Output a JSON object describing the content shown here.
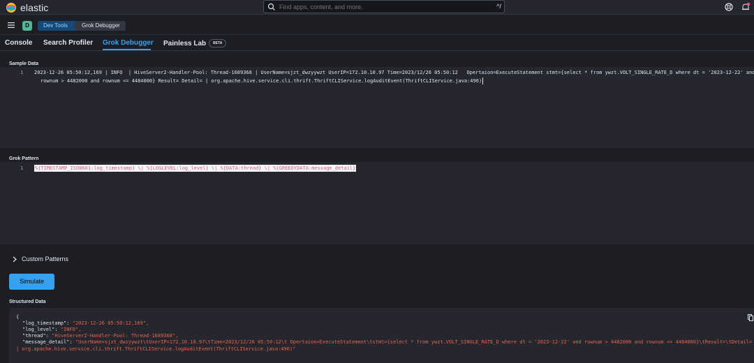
{
  "app": {
    "logo_text": "elastic",
    "search_placeholder": "Find apps, content, and more.",
    "search_shortcut": "^/",
    "space_initial": "D",
    "breadcrumbs": [
      "Dev Tools",
      "Grok Debugger"
    ]
  },
  "tabs": [
    {
      "label": "Console",
      "active": false
    },
    {
      "label": "Search Profiler",
      "active": false
    },
    {
      "label": "Grok Debugger",
      "active": true
    },
    {
      "label": "Painless Lab",
      "active": false,
      "badge": "BETA"
    }
  ],
  "sample_data": {
    "label": "Sample Data",
    "line_number": "1",
    "line1": "2023-12-26 05:50:12,169 | INFO  | HiveServer2-Handler-Pool: Thread-1689368 | UserName=sjzt_dwzyywzt UserIP=172.10.10.97 Time=2023/12/26 05:50:12   Opertaion=ExecuteStatement stmt={select * from ywzt.VOLT_SINGLE_RATE_D where dt = '2023-12-22' and",
    "line2": "rownum > 4482000 and rownum <= 4484000} Result= Detail= | org.apache.hive.service.cli.thrift.ThriftCLIService.logAuditEvent(ThriftCLIService.java:496)"
  },
  "grok_pattern": {
    "label": "Grok Pattern",
    "line_number": "1",
    "value": "%{TIMESTAMP_ISO8601:log_timestamp} \\| %{LOGLEVEL:log_level} \\| %{DATA:thread} \\| %{GREEDYDATA:message_detail}"
  },
  "custom_patterns": {
    "label": "Custom Patterns"
  },
  "simulate": {
    "label": "Simulate"
  },
  "structured_data": {
    "label": "Structured Data",
    "open_brace": "{",
    "fields": [
      {
        "key": "\"log_timestamp\"",
        "value": "\"2023-12-26 05:50:12,169\","
      },
      {
        "key": "\"log_level\"",
        "value": "\"INFO\","
      },
      {
        "key": "\"thread\"",
        "value": "\"HiveServer2-Handler-Pool: Thread-1689368\","
      },
      {
        "key": "\"message_detail\"",
        "value": "\"UserName=sjzt_dwzyywzt\\tUserIP=172.10.10.97\\tTime=2023/12/26 05:50:12\\t Opertaion=ExecuteStatement\\tstmt={select * from ywzt.VOLT_SINGLE_RATE_D where dt = '2023-12-22' and rownum > 4482000 and rownum <= 4484000}\\tResult=\\tDetail="
      }
    ],
    "continuation": "| org.apache.hive.service.cli.thrift.ThriftCLIService.logAuditEvent(ThriftCLIService.java:496)\""
  },
  "colors": {
    "accent": "#36a2ef",
    "background": "#1d1e24",
    "editor_bg": "#25262e",
    "json_value": "#e7664c"
  },
  "icons": [
    "elastic-logo-icon",
    "search-icon",
    "help-icon",
    "notifications-icon",
    "menu-icon",
    "chevron-right-icon",
    "copy-icon"
  ]
}
